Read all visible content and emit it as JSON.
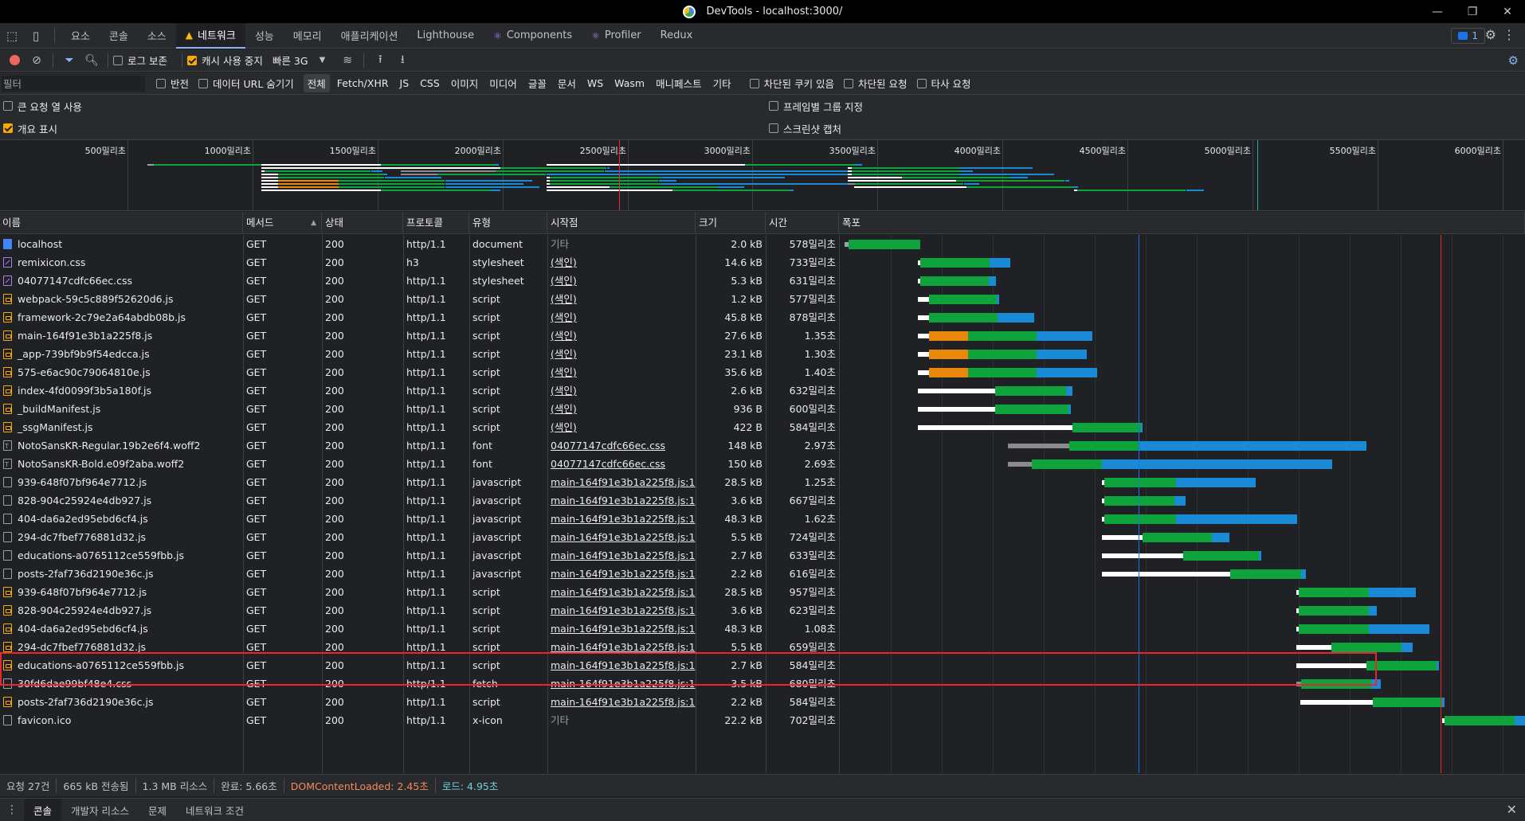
{
  "window": {
    "title": "DevTools - localhost:3000/"
  },
  "tabs": [
    {
      "label": "요소",
      "active": false,
      "icon": ""
    },
    {
      "label": "콘솔",
      "active": false,
      "icon": ""
    },
    {
      "label": "소스",
      "active": false,
      "icon": ""
    },
    {
      "label": "네트워크",
      "active": true,
      "icon": "warning-icon"
    },
    {
      "label": "성능",
      "active": false,
      "icon": ""
    },
    {
      "label": "메모리",
      "active": false,
      "icon": ""
    },
    {
      "label": "애플리케이션",
      "active": false,
      "icon": ""
    },
    {
      "label": "Lighthouse",
      "active": false,
      "icon": ""
    },
    {
      "label": "Components",
      "active": false,
      "icon": "react-icon"
    },
    {
      "label": "Profiler",
      "active": false,
      "icon": "react-icon"
    },
    {
      "label": "Redux",
      "active": false,
      "icon": ""
    }
  ],
  "issues_badge": "1",
  "toolbar": {
    "preserve_log": "로그 보존",
    "preserve_log_checked": false,
    "disable_cache": "캐시 사용 중지",
    "disable_cache_checked": true,
    "throttle": "빠른 3G"
  },
  "filter": {
    "placeholder": "필터",
    "invert": "반전",
    "hide_data_urls": "데이터 URL 숨기기",
    "types": [
      "전체",
      "Fetch/XHR",
      "JS",
      "CSS",
      "이미지",
      "미디어",
      "글꼴",
      "문서",
      "WS",
      "Wasm",
      "매니페스트",
      "기타"
    ],
    "active_type": "전체",
    "blocked_cookies": "차단된 쿠키 있음",
    "blocked_requests": "차단된 요청",
    "third_party": "타사 요청"
  },
  "settings": {
    "big_rows": "큰 요청 열 사용",
    "big_rows_checked": false,
    "overview": "개요 표시",
    "overview_checked": true,
    "group_by_frame": "프레임별 그룹 지정",
    "group_by_frame_checked": false,
    "screenshots": "스크린샷 캡처",
    "screenshots_checked": false
  },
  "overview_ticks": [
    "500밀리초",
    "1000밀리초",
    "1500밀리초",
    "2000밀리초",
    "2500밀리초",
    "3000밀리초",
    "3500밀리초",
    "4000밀리초",
    "4500밀리초",
    "5000밀리초",
    "5500밀리초",
    "6000밀리초"
  ],
  "columns": [
    "이름",
    "메서드",
    "상태",
    "프로토콜",
    "유형",
    "시작점",
    "크기",
    "시간",
    "폭포"
  ],
  "requests": [
    {
      "name": "localhost",
      "method": "GET",
      "status": "200",
      "protocol": "http/1.1",
      "type": "document",
      "initiator": "기타",
      "initiator_link": false,
      "size": "2.0 kB",
      "time": "578밀리초",
      "icon": "document",
      "wf": [
        [
          0,
          5,
          "#9aa0a6"
        ],
        [
          5,
          90,
          "#0fa33e"
        ]
      ]
    },
    {
      "name": "remixicon.css",
      "method": "GET",
      "status": "200",
      "protocol": "h3",
      "type": "stylesheet",
      "initiator": "(색인)",
      "initiator_link": true,
      "size": "14.6 kB",
      "time": "733밀리초",
      "icon": "stylesheet",
      "wf": [
        [
          92,
          3,
          "#ffffff"
        ],
        [
          95,
          87,
          "#0fa33e"
        ],
        [
          182,
          26,
          "#1a8ad6"
        ]
      ]
    },
    {
      "name": "04077147cdfc66ec.css",
      "method": "GET",
      "status": "200",
      "protocol": "http/1.1",
      "type": "stylesheet",
      "initiator": "(색인)",
      "initiator_link": true,
      "size": "5.3 kB",
      "time": "631밀리초",
      "icon": "stylesheet",
      "wf": [
        [
          92,
          3,
          "#ffffff"
        ],
        [
          95,
          86,
          "#0fa33e"
        ],
        [
          181,
          9,
          "#1a8ad6"
        ]
      ]
    },
    {
      "name": "webpack-59c5c889f52620d6.js",
      "method": "GET",
      "status": "200",
      "protocol": "http/1.1",
      "type": "script",
      "initiator": "(색인)",
      "initiator_link": true,
      "size": "1.2 kB",
      "time": "577밀리초",
      "icon": "script",
      "wf": [
        [
          92,
          14,
          "#ffffff"
        ],
        [
          106,
          85,
          "#0fa33e"
        ],
        [
          191,
          3,
          "#1a8ad6"
        ]
      ]
    },
    {
      "name": "framework-2c79e2a64abdb08b.js",
      "method": "GET",
      "status": "200",
      "protocol": "http/1.1",
      "type": "script",
      "initiator": "(색인)",
      "initiator_link": true,
      "size": "45.8 kB",
      "time": "878밀리초",
      "icon": "script",
      "wf": [
        [
          92,
          14,
          "#ffffff"
        ],
        [
          106,
          86,
          "#0fa33e"
        ],
        [
          192,
          46,
          "#1a8ad6"
        ]
      ]
    },
    {
      "name": "main-164f91e3b1a225f8.js",
      "method": "GET",
      "status": "200",
      "protocol": "http/1.1",
      "type": "script",
      "initiator": "(색인)",
      "initiator_link": true,
      "size": "27.6 kB",
      "time": "1.35초",
      "icon": "script",
      "wf": [
        [
          92,
          14,
          "#ffffff"
        ],
        [
          106,
          49,
          "#e8870a"
        ],
        [
          155,
          86,
          "#0fa33e"
        ],
        [
          241,
          70,
          "#1a8ad6"
        ]
      ]
    },
    {
      "name": "_app-739bf9b9f54edcca.js",
      "method": "GET",
      "status": "200",
      "protocol": "http/1.1",
      "type": "script",
      "initiator": "(색인)",
      "initiator_link": true,
      "size": "23.1 kB",
      "time": "1.30초",
      "icon": "script",
      "wf": [
        [
          92,
          14,
          "#ffffff"
        ],
        [
          106,
          49,
          "#e8870a"
        ],
        [
          155,
          86,
          "#0fa33e"
        ],
        [
          241,
          63,
          "#1a8ad6"
        ]
      ]
    },
    {
      "name": "575-e6ac90c79064810e.js",
      "method": "GET",
      "status": "200",
      "protocol": "http/1.1",
      "type": "script",
      "initiator": "(색인)",
      "initiator_link": true,
      "size": "35.6 kB",
      "time": "1.40초",
      "icon": "script",
      "wf": [
        [
          92,
          14,
          "#ffffff"
        ],
        [
          106,
          49,
          "#e8870a"
        ],
        [
          155,
          86,
          "#0fa33e"
        ],
        [
          241,
          76,
          "#1a8ad6"
        ]
      ]
    },
    {
      "name": "index-4fd0099f3b5a180f.js",
      "method": "GET",
      "status": "200",
      "protocol": "http/1.1",
      "type": "script",
      "initiator": "(색인)",
      "initiator_link": true,
      "size": "2.6 kB",
      "time": "632밀리초",
      "icon": "script",
      "wf": [
        [
          92,
          97,
          "#ffffff"
        ],
        [
          189,
          89,
          "#0fa33e"
        ],
        [
          278,
          8,
          "#1a8ad6"
        ]
      ]
    },
    {
      "name": "_buildManifest.js",
      "method": "GET",
      "status": "200",
      "protocol": "http/1.1",
      "type": "script",
      "initiator": "(색인)",
      "initiator_link": true,
      "size": "936 B",
      "time": "600밀리초",
      "icon": "script",
      "wf": [
        [
          92,
          97,
          "#ffffff"
        ],
        [
          189,
          92,
          "#0fa33e"
        ],
        [
          281,
          3,
          "#1a8ad6"
        ]
      ]
    },
    {
      "name": "_ssgManifest.js",
      "method": "GET",
      "status": "200",
      "protocol": "http/1.1",
      "type": "script",
      "initiator": "(색인)",
      "initiator_link": true,
      "size": "422 B",
      "time": "584밀리초",
      "icon": "script",
      "wf": [
        [
          92,
          194,
          "#ffffff"
        ],
        [
          286,
          86,
          "#0fa33e"
        ],
        [
          372,
          2,
          "#1a8ad6"
        ]
      ]
    },
    {
      "name": "NotoSansKR-Regular.19b2e6f4.woff2",
      "method": "GET",
      "status": "200",
      "protocol": "http/1.1",
      "type": "font",
      "initiator": "04077147cdfc66ec.css",
      "initiator_link": true,
      "size": "148 kB",
      "time": "2.97초",
      "icon": "font",
      "wf": [
        [
          205,
          77,
          "#8b8b8b"
        ],
        [
          282,
          88,
          "#0fa33e"
        ],
        [
          370,
          285,
          "#1a8ad6"
        ]
      ]
    },
    {
      "name": "NotoSansKR-Bold.e09f2aba.woff2",
      "method": "GET",
      "status": "200",
      "protocol": "http/1.1",
      "type": "font",
      "initiator": "04077147cdfc66ec.css",
      "initiator_link": true,
      "size": "150 kB",
      "time": "2.69초",
      "icon": "font",
      "wf": [
        [
          205,
          30,
          "#8b8b8b"
        ],
        [
          235,
          88,
          "#0fa33e"
        ],
        [
          323,
          289,
          "#1a8ad6"
        ]
      ]
    },
    {
      "name": "939-648f07bf964e7712.js",
      "method": "GET",
      "status": "200",
      "protocol": "http/1.1",
      "type": "javascript",
      "initiator": "main-164f91e3b1a225f8.js:1",
      "initiator_link": true,
      "size": "28.5 kB",
      "time": "1.25초",
      "icon": "javascript",
      "wf": [
        [
          323,
          3,
          "#ffffff"
        ],
        [
          326,
          90,
          "#0fa33e"
        ],
        [
          416,
          100,
          "#1a8ad6"
        ]
      ]
    },
    {
      "name": "828-904c25924e4db927.js",
      "method": "GET",
      "status": "200",
      "protocol": "http/1.1",
      "type": "javascript",
      "initiator": "main-164f91e3b1a225f8.js:1",
      "initiator_link": true,
      "size": "3.6 kB",
      "time": "667밀리초",
      "icon": "javascript",
      "wf": [
        [
          323,
          3,
          "#ffffff"
        ],
        [
          326,
          88,
          "#0fa33e"
        ],
        [
          414,
          14,
          "#1a8ad6"
        ]
      ]
    },
    {
      "name": "404-da6a2ed95ebd6cf4.js",
      "method": "GET",
      "status": "200",
      "protocol": "http/1.1",
      "type": "javascript",
      "initiator": "main-164f91e3b1a225f8.js:1",
      "initiator_link": true,
      "size": "48.3 kB",
      "time": "1.62초",
      "icon": "javascript",
      "wf": [
        [
          323,
          3,
          "#ffffff"
        ],
        [
          326,
          90,
          "#0fa33e"
        ],
        [
          416,
          152,
          "#1a8ad6"
        ]
      ]
    },
    {
      "name": "294-dc7fbef776881d32.js",
      "method": "GET",
      "status": "200",
      "protocol": "http/1.1",
      "type": "javascript",
      "initiator": "main-164f91e3b1a225f8.js:1",
      "initiator_link": true,
      "size": "5.5 kB",
      "time": "724밀리초",
      "icon": "javascript",
      "wf": [
        [
          323,
          51,
          "#ffffff"
        ],
        [
          374,
          87,
          "#0fa33e"
        ],
        [
          461,
          22,
          "#1a8ad6"
        ]
      ]
    },
    {
      "name": "educations-a0765112ce559fbb.js",
      "method": "GET",
      "status": "200",
      "protocol": "http/1.1",
      "type": "javascript",
      "initiator": "main-164f91e3b1a225f8.js:1",
      "initiator_link": true,
      "size": "2.7 kB",
      "time": "633밀리초",
      "icon": "javascript",
      "wf": [
        [
          323,
          102,
          "#ffffff"
        ],
        [
          425,
          95,
          "#0fa33e"
        ],
        [
          520,
          3,
          "#1a8ad6"
        ]
      ]
    },
    {
      "name": "posts-2faf736d2190e36c.js",
      "method": "GET",
      "status": "200",
      "protocol": "http/1.1",
      "type": "javascript",
      "initiator": "main-164f91e3b1a225f8.js:1",
      "initiator_link": true,
      "size": "2.2 kB",
      "time": "616밀리초",
      "icon": "javascript",
      "wf": [
        [
          323,
          161,
          "#ffffff"
        ],
        [
          484,
          89,
          "#0fa33e"
        ],
        [
          573,
          6,
          "#1a8ad6"
        ]
      ]
    },
    {
      "name": "939-648f07bf964e7712.js",
      "method": "GET",
      "status": "200",
      "protocol": "http/1.1",
      "type": "script",
      "initiator": "main-164f91e3b1a225f8.js:1",
      "initiator_link": true,
      "size": "28.5 kB",
      "time": "957밀리초",
      "icon": "script",
      "wf": [
        [
          567,
          3,
          "#ffffff"
        ],
        [
          570,
          88,
          "#0fa33e"
        ],
        [
          658,
          59,
          "#1a8ad6"
        ]
      ]
    },
    {
      "name": "828-904c25924e4db927.js",
      "method": "GET",
      "status": "200",
      "protocol": "http/1.1",
      "type": "script",
      "initiator": "main-164f91e3b1a225f8.js:1",
      "initiator_link": true,
      "size": "3.6 kB",
      "time": "623밀리초",
      "icon": "script",
      "wf": [
        [
          567,
          3,
          "#ffffff"
        ],
        [
          570,
          88,
          "#0fa33e"
        ],
        [
          658,
          10,
          "#1a8ad6"
        ]
      ]
    },
    {
      "name": "404-da6a2ed95ebd6cf4.js",
      "method": "GET",
      "status": "200",
      "protocol": "http/1.1",
      "type": "script",
      "initiator": "main-164f91e3b1a225f8.js:1",
      "initiator_link": true,
      "size": "48.3 kB",
      "time": "1.08초",
      "icon": "script",
      "wf": [
        [
          567,
          3,
          "#ffffff"
        ],
        [
          570,
          88,
          "#0fa33e"
        ],
        [
          658,
          76,
          "#1a8ad6"
        ]
      ]
    },
    {
      "name": "294-dc7fbef776881d32.js",
      "method": "GET",
      "status": "200",
      "protocol": "http/1.1",
      "type": "script",
      "initiator": "main-164f91e3b1a225f8.js:1",
      "initiator_link": true,
      "size": "5.5 kB",
      "time": "659밀리초",
      "icon": "script",
      "wf": [
        [
          567,
          44,
          "#ffffff"
        ],
        [
          611,
          88,
          "#0fa33e"
        ],
        [
          699,
          14,
          "#1a8ad6"
        ]
      ]
    },
    {
      "name": "educations-a0765112ce559fbb.js",
      "method": "GET",
      "status": "200",
      "protocol": "http/1.1",
      "type": "script",
      "initiator": "main-164f91e3b1a225f8.js:1",
      "initiator_link": true,
      "size": "2.7 kB",
      "time": "584밀리초",
      "icon": "script",
      "wf": [
        [
          567,
          88,
          "#ffffff"
        ],
        [
          655,
          88,
          "#0fa33e"
        ],
        [
          743,
          3,
          "#1a8ad6"
        ]
      ]
    },
    {
      "name": "30fd6dae99bf48e4.css",
      "method": "GET",
      "status": "200",
      "protocol": "http/1.1",
      "type": "fetch",
      "initiator": "main-164f91e3b1a225f8.js:1",
      "initiator_link": true,
      "size": "3.5 kB",
      "time": "680밀리초",
      "icon": "fetch",
      "wf": [
        [
          567,
          6,
          "#8b8b8b"
        ],
        [
          573,
          88,
          "#0fa33e"
        ],
        [
          661,
          12,
          "#1a8ad6"
        ]
      ]
    },
    {
      "name": "posts-2faf736d2190e36c.js",
      "method": "GET",
      "status": "200",
      "protocol": "http/1.1",
      "type": "script",
      "initiator": "main-164f91e3b1a225f8.js:1",
      "initiator_link": true,
      "size": "2.2 kB",
      "time": "584밀리초",
      "icon": "script",
      "wf": [
        [
          572,
          91,
          "#ffffff"
        ],
        [
          663,
          87,
          "#0fa33e"
        ],
        [
          750,
          3,
          "#1a8ad6"
        ]
      ]
    },
    {
      "name": "favicon.ico",
      "method": "GET",
      "status": "200",
      "protocol": "http/1.1",
      "type": "x-icon",
      "initiator": "기타",
      "initiator_link": false,
      "size": "22.2 kB",
      "time": "702밀리초",
      "icon": "xicon",
      "wf": [
        [
          750,
          3,
          "#ffffff"
        ],
        [
          753,
          88,
          "#0fa33e"
        ],
        [
          841,
          14,
          "#1a8ad6"
        ]
      ]
    }
  ],
  "status": {
    "requests": "요청 27건",
    "transferred": "665 kB 전송됨",
    "resources": "1.3 MB 리소스",
    "finish": "완료: 5.66초",
    "dcl": "DOMContentLoaded: 2.45초",
    "load": "로드: 4.95초"
  },
  "drawer_tabs": [
    "콘솔",
    "개발자 리소스",
    "문제",
    "네트워크 조건"
  ],
  "colors": {
    "waiting": "#0fa33e",
    "download": "#1a8ad6",
    "queue": "#ffffff",
    "stalled": "#e8870a",
    "dcl_line": "#1a73e8",
    "load_line": "#e8262d",
    "highlight": "#e8262d"
  }
}
